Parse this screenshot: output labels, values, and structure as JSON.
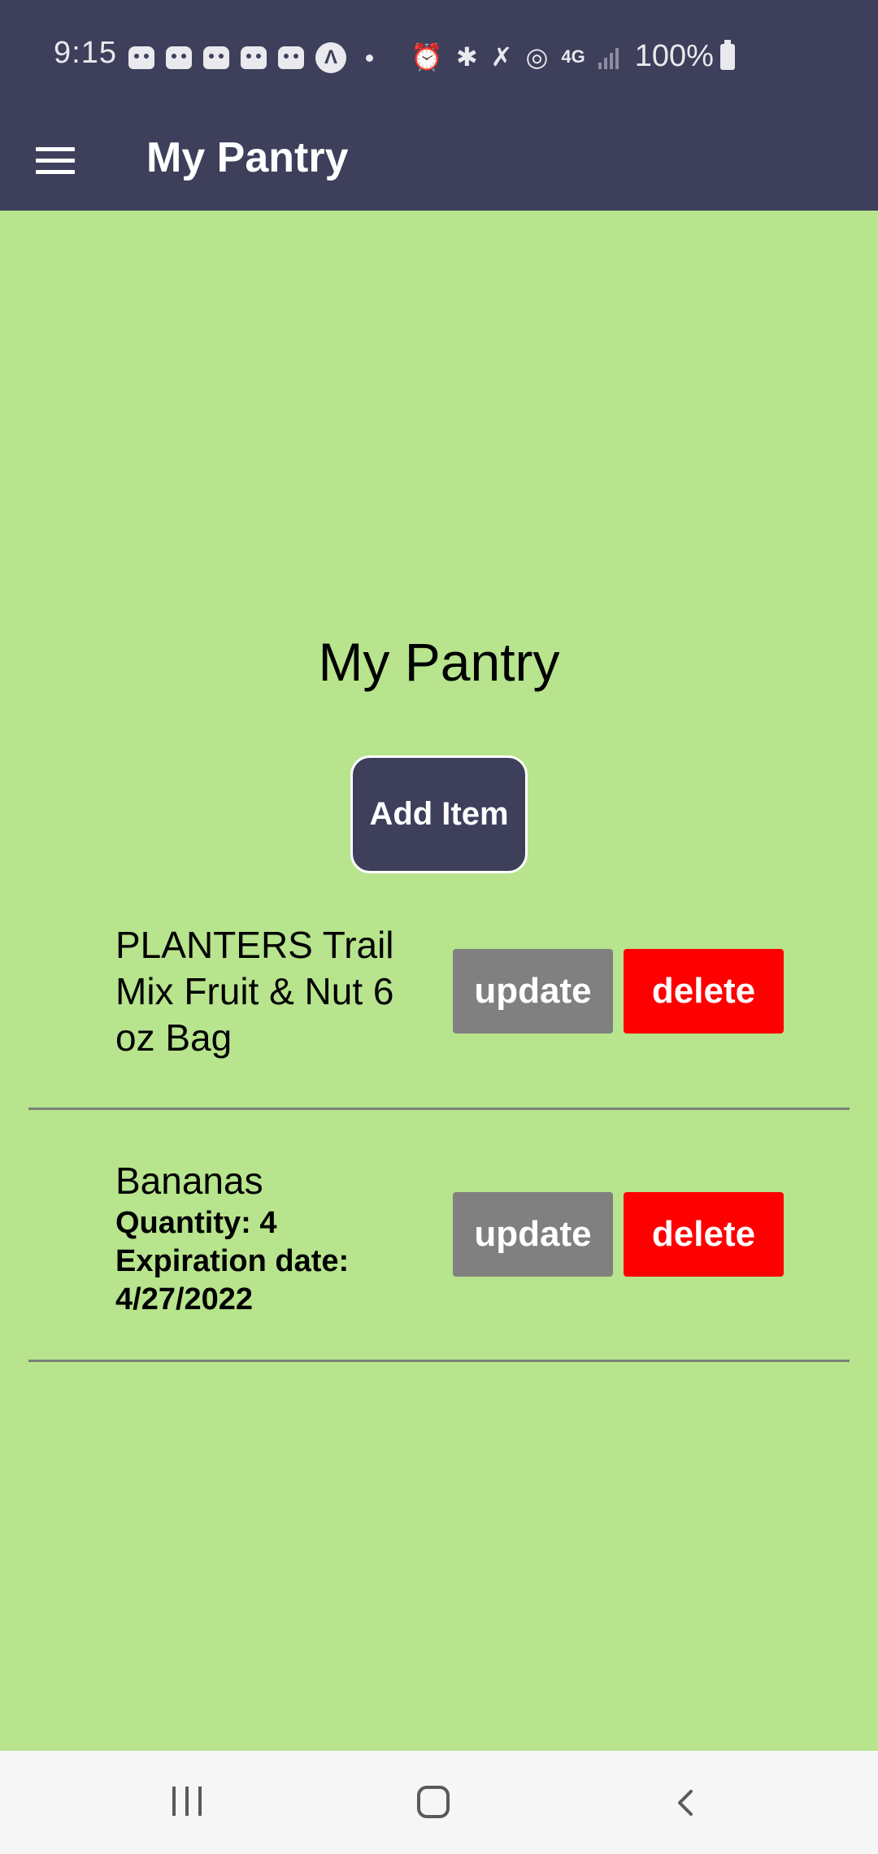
{
  "status_bar": {
    "time": "9:15",
    "battery": "100%",
    "icons": [
      "chat-notification-icon",
      "chat-notification-icon",
      "chat-notification-icon",
      "chat-notification-icon",
      "chat-notification-icon",
      "app-a-icon",
      "dot-icon",
      "alarm-icon",
      "bluetooth-icon",
      "mute-icon",
      "hotspot-icon",
      "4g-data-icon",
      "signal-icon",
      "battery-icon"
    ]
  },
  "app_bar": {
    "title": "My Pantry",
    "menu_icon": "hamburger-menu-icon"
  },
  "main": {
    "title": "My Pantry",
    "add_button_label": "Add Item",
    "items": [
      {
        "name": "PLANTERS Trail Mix Fruit & Nut  6 oz Bag",
        "update_label": "update",
        "delete_label": "delete"
      },
      {
        "name": "Bananas",
        "quantity": "Quantity: 4",
        "expiration": "Expiration date: 4/27/2022",
        "update_label": "update",
        "delete_label": "delete"
      }
    ]
  },
  "nav_bar": {
    "icons": [
      "recents-icon",
      "home-icon",
      "back-icon"
    ]
  },
  "colors": {
    "header": "#3d3f5b",
    "background": "#b7e48d",
    "update_button": "#808080",
    "delete_button": "#ff0000"
  }
}
